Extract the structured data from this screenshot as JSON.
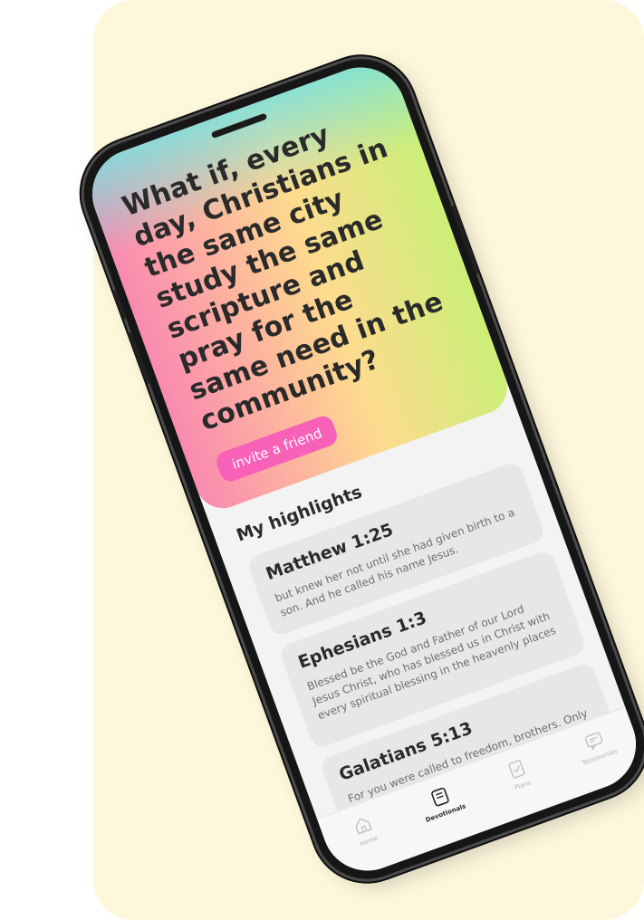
{
  "hero": {
    "title": "What if, every day, Christians in the same city study the same scripture and pray for the same need in the community?",
    "invite_label": "invite a friend"
  },
  "highlights": {
    "title": "My highlights",
    "items": [
      {
        "ref": "Matthew 1:25",
        "text": "but knew her not until she had given birth to a son. And he called his name Jesus."
      },
      {
        "ref": "Ephesians 1:3",
        "text": "Blessed be the God and Father of our Lord Jesus Christ, who has blessed us in Christ with every spiritual blessing in the heavenly places"
      },
      {
        "ref": "Galatians 5:13",
        "text": "For you were called to freedom, brothers. Only do not use your freedom as an opportunity for the flesh, but through love serve one another."
      }
    ]
  },
  "tabbar": {
    "tabs": [
      {
        "label": "Home",
        "icon": "home-icon"
      },
      {
        "label": "Devotionals",
        "icon": "devotionals-icon"
      },
      {
        "label": "Plans",
        "icon": "plans-icon"
      },
      {
        "label": "Testimonies",
        "icon": "testimonies-icon"
      }
    ],
    "active_tab": "Devotionals"
  },
  "colors": {
    "background": "#fdf7dc",
    "accent_pink": "#f761b8",
    "card": "#e7e7e7",
    "text_dark": "#2a2a2a"
  }
}
